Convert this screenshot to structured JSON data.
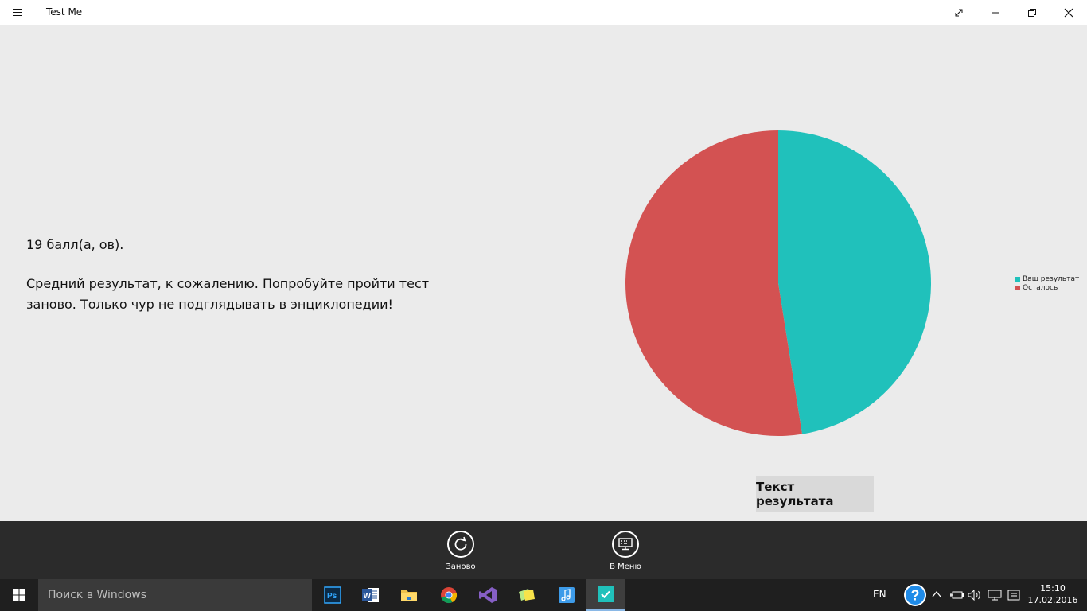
{
  "window": {
    "title": "Test Me",
    "controls": [
      "fullscreen",
      "minimize",
      "restore",
      "close"
    ]
  },
  "result": {
    "score_text": "19 балл(а, ов).",
    "message": "Средний результат, к сожалению. Попробуйте пройти тест заново. Только чур не подглядывать в энциклопедии!",
    "result_button_label": "Текст результата"
  },
  "chart_data": {
    "type": "pie",
    "categories": [
      "Ваш результат",
      "Осталось"
    ],
    "values": [
      47.5,
      52.5
    ],
    "colors": [
      "#20c1bb",
      "#d35252"
    ],
    "title": "",
    "legend_position": "right"
  },
  "commands": {
    "again_label": "Заново",
    "menu_label": "В Меню"
  },
  "taskbar": {
    "search_placeholder": "Поиск в Windows",
    "apps": [
      "photoshop-icon",
      "word-icon",
      "file-explorer-icon",
      "chrome-icon",
      "visual-studio-icon",
      "sticky-notes-icon",
      "music-app-icon",
      "test-me-app-icon"
    ],
    "language": "EN",
    "time": "15:10",
    "date": "17.02.2016"
  }
}
